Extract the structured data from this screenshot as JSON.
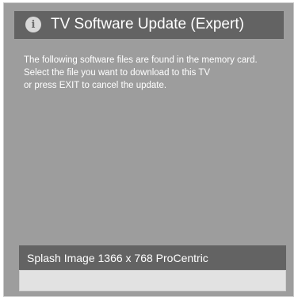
{
  "dialog": {
    "title": "TV Software Update (Expert)",
    "info_icon": "info-icon",
    "message_lines": [
      "The following software files are found in the memory card.",
      "Select the file you want to download to this TV",
      "or press EXIT to cancel the update."
    ],
    "files": [
      "Splash Image 1366 x 768 ProCentric"
    ]
  },
  "colors": {
    "panel": "#9d9d9d",
    "title_bar": "#636363",
    "selected_item": "#636363",
    "empty_item": "#e2e2e2"
  }
}
